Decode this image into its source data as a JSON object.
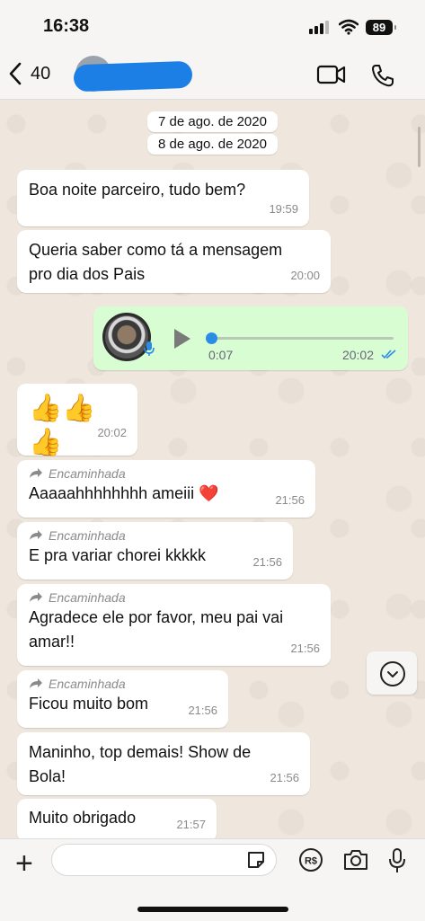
{
  "status_bar": {
    "time": "16:38",
    "battery": "89"
  },
  "header": {
    "back_count": "40"
  },
  "dates": [
    "7 de ago. de 2020",
    "8 de ago. de 2020"
  ],
  "messages": [
    {
      "text": "Boa noite parceiro, tudo bem?",
      "time": "19:59"
    },
    {
      "text": "Queria saber como tá a mensagem pro dia dos Pais",
      "time": "20:00"
    },
    {
      "text": "👍👍👍",
      "time": "20:02"
    },
    {
      "forwarded": "Encaminhada",
      "text": "Aaaaahhhhhhhh ameiii ❤️",
      "time": "21:56"
    },
    {
      "forwarded": "Encaminhada",
      "text": "E pra variar chorei kkkkk",
      "time": "21:56"
    },
    {
      "forwarded": "Encaminhada",
      "text": "Agradece ele por favor, meu pai vai amar!!",
      "time": "21:56"
    },
    {
      "forwarded": "Encaminhada",
      "text": "Ficou muito bom",
      "time": "21:56"
    },
    {
      "text": "Maninho, top demais! Show de Bola!",
      "time": "21:56"
    },
    {
      "text": "Muito obrigado",
      "time": "21:57"
    }
  ],
  "voice_message": {
    "duration": "0:07",
    "time": "20:02",
    "progress": 0
  },
  "composer": {
    "placeholder": ""
  },
  "colors": {
    "outgoing_bubble": "#d9fdd3",
    "incoming_bubble": "#ffffff",
    "read_ticks": "#2b8ce6"
  },
  "icons": [
    "back-chevron-icon",
    "video-call-icon",
    "phone-icon",
    "play-icon",
    "mic-icon",
    "double-check-icon",
    "scroll-down-icon",
    "plus-icon",
    "sticker-icon",
    "payment-icon",
    "camera-icon",
    "microphone-icon"
  ]
}
